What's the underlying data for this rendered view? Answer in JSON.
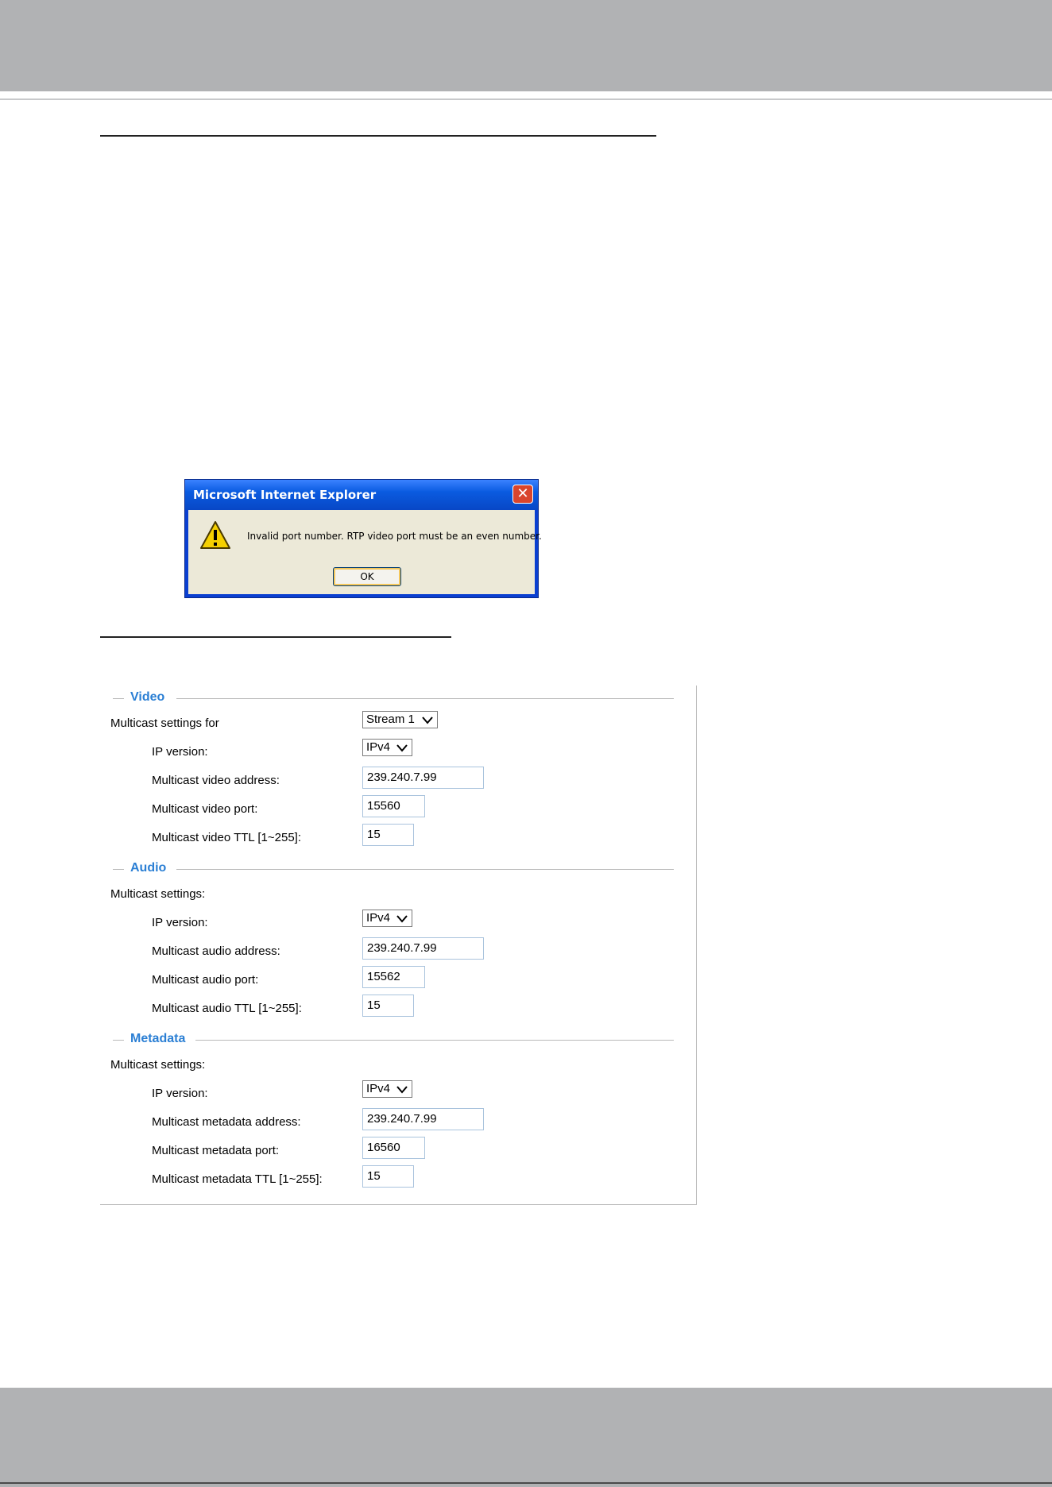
{
  "dialog": {
    "title": "Microsoft Internet Explorer",
    "close_glyph": "✕",
    "message": "Invalid port number. RTP video port must be an even number.",
    "ok_label": "OK",
    "icon": "warning-icon"
  },
  "video": {
    "title": "Video",
    "for_label": "Multicast settings for",
    "stream_value": "Stream 1",
    "ip_version_label": "IP version:",
    "ip_version_value": "IPv4",
    "address_label": "Multicast video address:",
    "address_value": "239.240.7.99",
    "port_label": "Multicast video port:",
    "port_value": "15560",
    "ttl_label": "Multicast video TTL [1~255]:",
    "ttl_value": "15"
  },
  "audio": {
    "title": "Audio",
    "settings_label": "Multicast settings:",
    "ip_version_label": "IP version:",
    "ip_version_value": "IPv4",
    "address_label": "Multicast audio address:",
    "address_value": "239.240.7.99",
    "port_label": "Multicast audio port:",
    "port_value": "15562",
    "ttl_label": "Multicast audio TTL [1~255]:",
    "ttl_value": "15"
  },
  "metadata": {
    "title": "Metadata",
    "settings_label": "Multicast settings:",
    "ip_version_label": "IP version:",
    "ip_version_value": "IPv4",
    "address_label": "Multicast metadata address:",
    "address_value": "239.240.7.99",
    "port_label": "Multicast metadata port:",
    "port_value": "16560",
    "ttl_label": "Multicast metadata TTL [1~255]:",
    "ttl_value": "15"
  },
  "colors": {
    "header_band": "#b1b2b4",
    "section_title": "#2b7fd4",
    "dialog_title_bar": "#0a5be0"
  }
}
